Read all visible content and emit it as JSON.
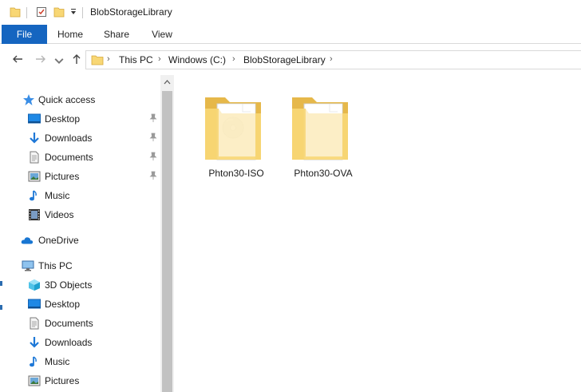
{
  "window": {
    "title": "BlobStorageLibrary"
  },
  "ribbon": {
    "tabs": [
      {
        "label": "File"
      },
      {
        "label": "Home"
      },
      {
        "label": "Share"
      },
      {
        "label": "View"
      }
    ]
  },
  "address": {
    "breadcrumbs": [
      "This PC",
      "Windows (C:)",
      "BlobStorageLibrary"
    ]
  },
  "nav": {
    "quick_access": {
      "label": "Quick access",
      "items": [
        {
          "label": "Desktop",
          "pinned": true
        },
        {
          "label": "Downloads",
          "pinned": true
        },
        {
          "label": "Documents",
          "pinned": true
        },
        {
          "label": "Pictures",
          "pinned": true
        },
        {
          "label": "Music",
          "pinned": false
        },
        {
          "label": "Videos",
          "pinned": false
        }
      ]
    },
    "onedrive": {
      "label": "OneDrive"
    },
    "this_pc": {
      "label": "This PC",
      "items": [
        {
          "label": "3D Objects"
        },
        {
          "label": "Desktop"
        },
        {
          "label": "Documents"
        },
        {
          "label": "Downloads"
        },
        {
          "label": "Music"
        },
        {
          "label": "Pictures"
        }
      ]
    }
  },
  "content": {
    "items": [
      {
        "label": "Phton30-ISO",
        "icon": "folder-disc-icon"
      },
      {
        "label": "Phton30-OVA",
        "icon": "folder-document-icon"
      }
    ]
  },
  "colors": {
    "file_tab": "#1565c0",
    "folder": "#f8d775",
    "folder_dark": "#e6b84a",
    "accent_blue": "#1e88e5"
  }
}
